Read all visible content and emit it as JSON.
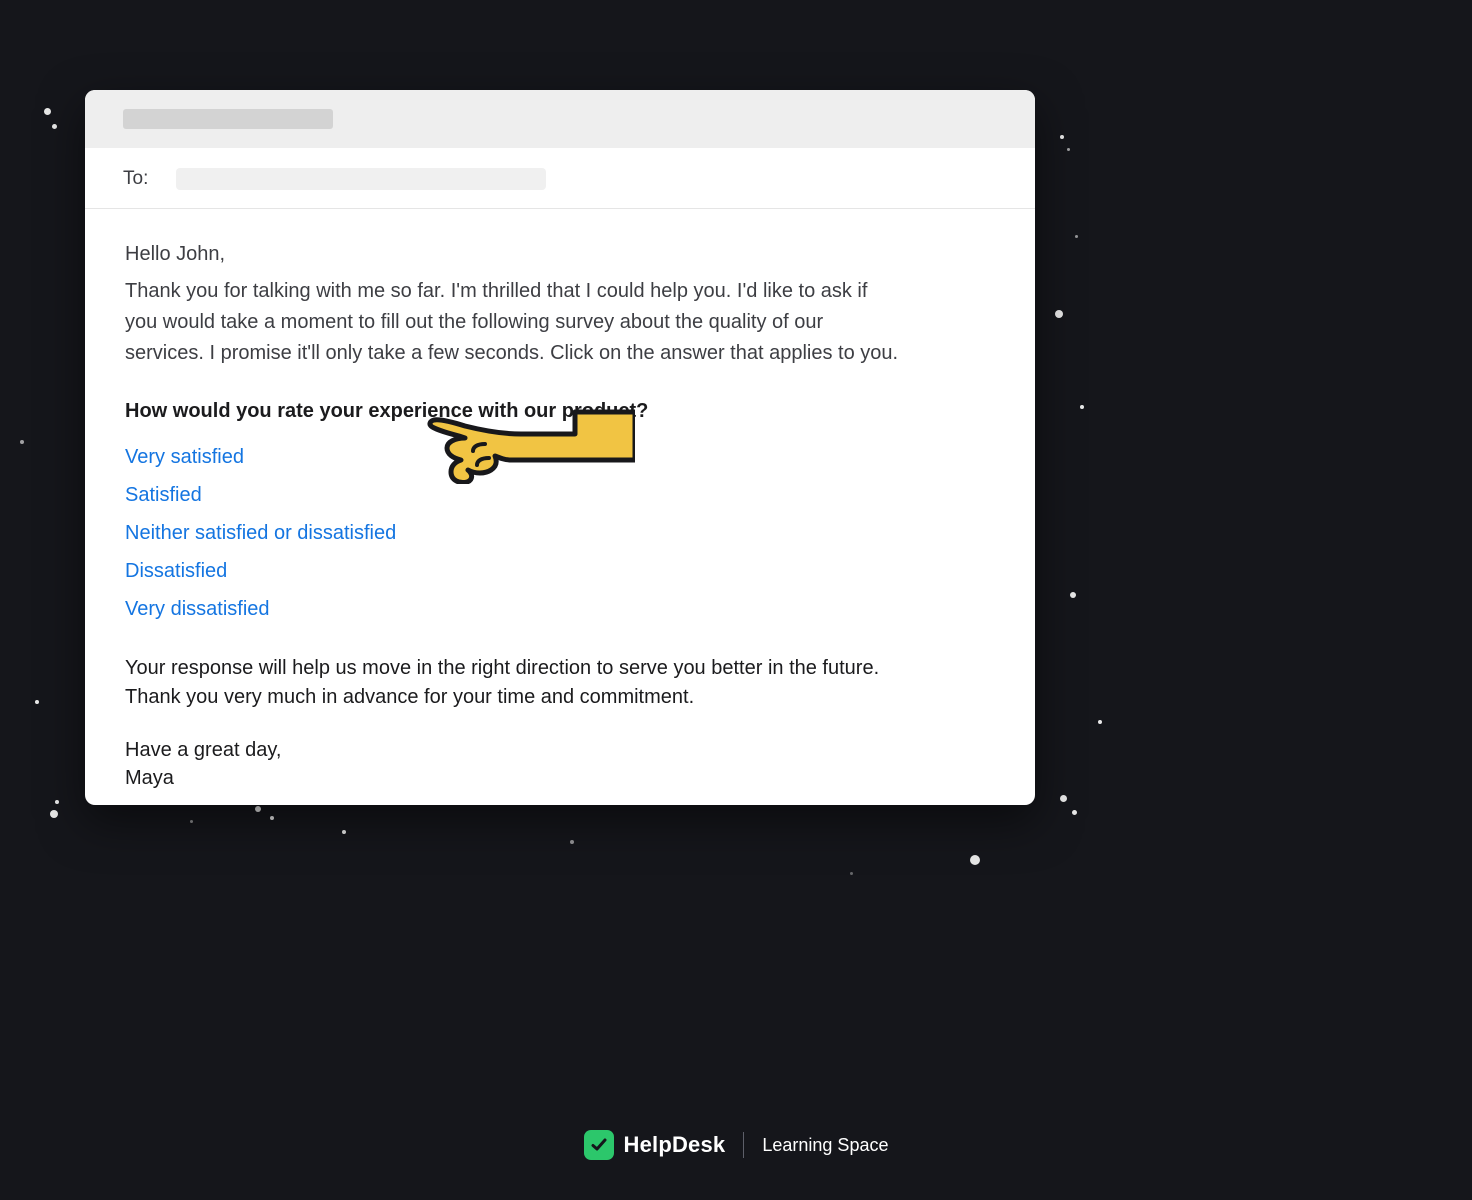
{
  "email": {
    "to_label": "To:",
    "greeting": "Hello John,",
    "intro": "Thank you for talking with me so far. I'm thrilled that I could help you. I'd like to ask if you would take a moment to fill out the following survey about the quality of our services. I promise it'll only take a few seconds. Click on the answer that applies to you.",
    "question": "How would you rate your experience with our product?",
    "options": [
      "Very satisfied",
      "Satisfied",
      "Neither satisfied or dissatisfied",
      "Dissatisfied",
      "Very dissatisfied"
    ],
    "footer": "Your response will help us move in the right direction to serve you better in the future. Thank you very much in advance for your time and commitment.",
    "signoff_line1": "Have a great day,",
    "signoff_line2": "Maya"
  },
  "brand": {
    "name": "HelpDesk",
    "subtitle": "Learning Space"
  },
  "colors": {
    "link": "#1475e1",
    "accent_green": "#2cc76b",
    "bg": "#15161b",
    "hand_fill": "#f1c443"
  }
}
